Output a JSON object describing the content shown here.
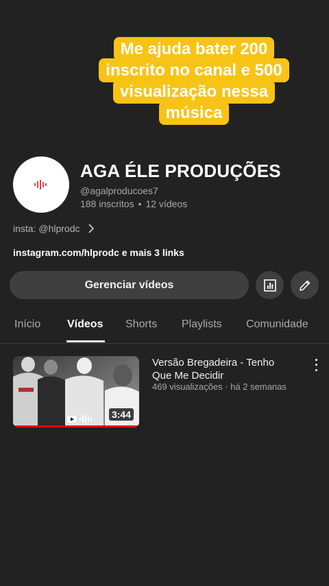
{
  "overlay": {
    "lines": [
      "Me ajuda bater 200",
      "inscrito no canal e 500",
      "visualização nessa",
      "música"
    ],
    "color": "#f7c415"
  },
  "channel": {
    "name": "AGA ÉLE PRODUÇÕES",
    "handle": "@agalproducoes7",
    "subscribers": "188 inscritos",
    "videos": "12 vídeos",
    "separator": "•",
    "bio": "insta: @hlprodc",
    "links": "instagram.com/hlprodc e mais 3 links",
    "avatar_icon": "soundwave-logo-icon"
  },
  "actions": {
    "manage_label": "Gerenciar vídeos",
    "analytics_icon": "bar-chart-icon",
    "edit_icon": "pencil-icon"
  },
  "tabs": [
    {
      "label": "Início",
      "active": false
    },
    {
      "label": "Vídeos",
      "active": true
    },
    {
      "label": "Shorts",
      "active": false
    },
    {
      "label": "Playlists",
      "active": false
    },
    {
      "label": "Comunidade",
      "active": false
    }
  ],
  "videos": [
    {
      "title": "Versão Bregadeira - Tenho Que Me Decidir",
      "views": "469 visualizações",
      "age": "há 2 semanas",
      "meta_sep": "·",
      "duration": "3:44",
      "watched_fraction": 1.0,
      "progress_color": "#ff0000"
    }
  ]
}
